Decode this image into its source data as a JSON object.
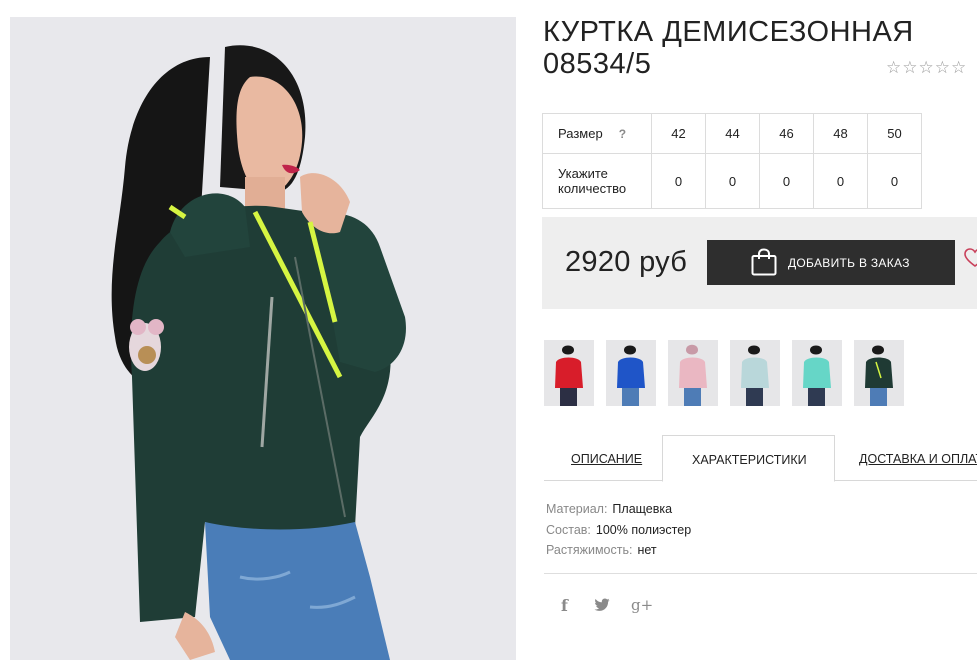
{
  "product": {
    "title": "КУРТКА ДЕМИСЕЗОННАЯ 08534/5",
    "rating": {
      "value": 0,
      "max": 5,
      "star_glyph": "☆"
    },
    "main_image": {
      "description_icon": "woman-green-jacket-photo"
    }
  },
  "size_table": {
    "size_label": "Размер",
    "help_label": "?",
    "qty_label": "Укажите количество",
    "sizes": [
      "42",
      "44",
      "46",
      "48",
      "50"
    ],
    "quantities": [
      "0",
      "0",
      "0",
      "0",
      "0"
    ]
  },
  "buy": {
    "price": "2920 руб",
    "add_button_label": "ДОБАВИТЬ В ЗАКАЗ",
    "bag_icon": "shopping-bag-icon",
    "heart_icon": "heart-icon"
  },
  "thumbnails": [
    {
      "color": "#d81d2a",
      "name": "red"
    },
    {
      "color": "#1f55c8",
      "name": "blue"
    },
    {
      "color": "#eab7c2",
      "name": "pink"
    },
    {
      "color": "#b9d7da",
      "name": "light-mint"
    },
    {
      "color": "#66d6c7",
      "name": "turquoise"
    },
    {
      "color": "#1f3a34",
      "name": "dark-green"
    }
  ],
  "tabs": [
    {
      "label": "ОПИСАНИЕ",
      "active": false
    },
    {
      "label": "ХАРАКТЕРИСТИКИ",
      "active": true
    },
    {
      "label": "ДОСТАВКА И ОПЛАТА",
      "active": false
    }
  ],
  "specs": [
    {
      "key": "Материал:",
      "value": "Плащевка"
    },
    {
      "key": "Состав:",
      "value": "100% полиэстер"
    },
    {
      "key": "Растяжимость:",
      "value": "нет"
    }
  ],
  "social": [
    {
      "name": "facebook-icon",
      "glyph": "f"
    },
    {
      "name": "twitter-icon",
      "glyph": ""
    },
    {
      "name": "google-plus-icon",
      "glyph": "g+"
    }
  ],
  "colors": {
    "button_bg": "#2e2e2e",
    "panel_bg": "#eeeeee",
    "jacket": "#1f3d36",
    "accent_lime": "#d6f542"
  }
}
